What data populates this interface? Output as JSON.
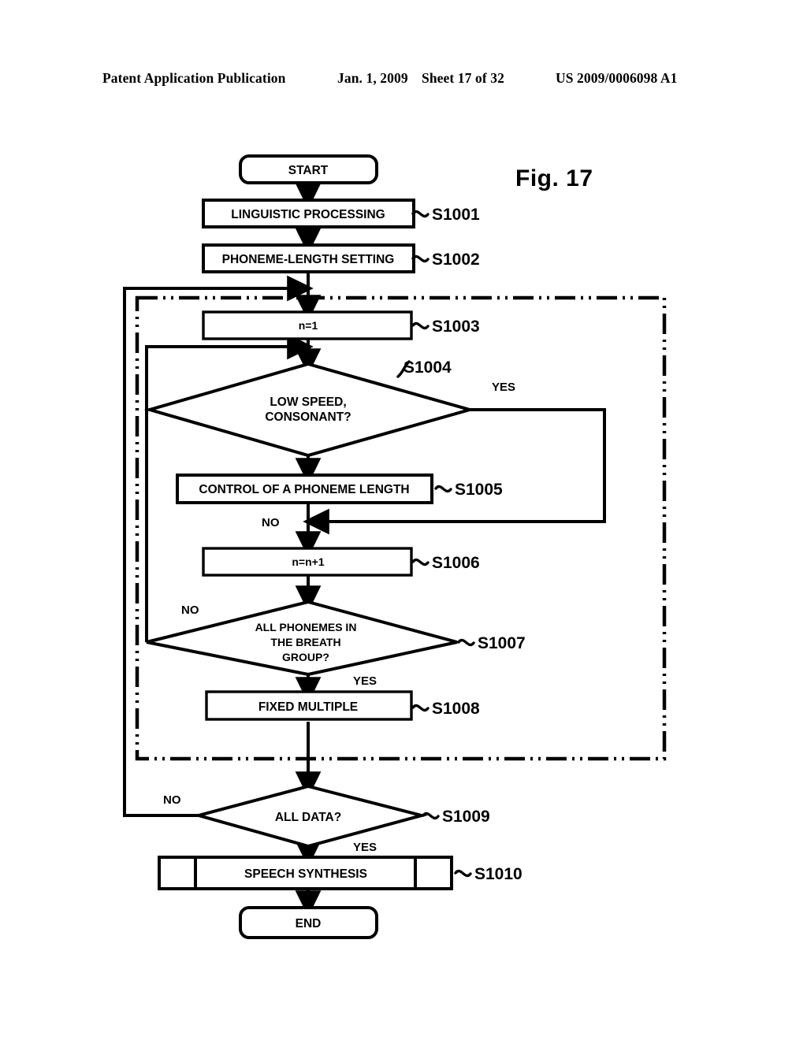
{
  "header": {
    "publication": "Patent Application Publication",
    "date": "Jan. 1, 2009",
    "sheet": "Sheet 17 of 32",
    "patent_number": "US 2009/0006098 A1"
  },
  "figure": {
    "label": "Fig. 17"
  },
  "flowchart": {
    "nodes": {
      "start": "START",
      "s1001": "LINGUISTIC PROCESSING",
      "s1002": "PHONEME-LENGTH SETTING",
      "s1003": "n=1",
      "s1004_line1": "LOW SPEED,",
      "s1004_line2": "CONSONANT?",
      "s1005": "CONTROL OF A PHONEME LENGTH",
      "s1006": "n=n+1",
      "s1007_line1": "ALL PHONEMES IN",
      "s1007_line2": "THE BREATH",
      "s1007_line3": "GROUP?",
      "s1008": "FIXED MULTIPLE",
      "s1009": "ALL DATA?",
      "s1010": "SPEECH SYNTHESIS",
      "end": "END"
    },
    "step_labels": {
      "s1001": "S1001",
      "s1002": "S1002",
      "s1003": "S1003",
      "s1004": "S1004",
      "s1005": "S1005",
      "s1006": "S1006",
      "s1007": "S1007",
      "s1008": "S1008",
      "s1009": "S1009",
      "s1010": "S1010"
    },
    "branch_labels": {
      "s1004_yes": "YES",
      "s1004_no": "NO",
      "s1007_no": "NO",
      "s1007_yes": "YES",
      "s1009_no": "NO",
      "s1009_yes": "YES"
    },
    "colors": {
      "stroke": "#000000",
      "fill": "#ffffff"
    }
  }
}
